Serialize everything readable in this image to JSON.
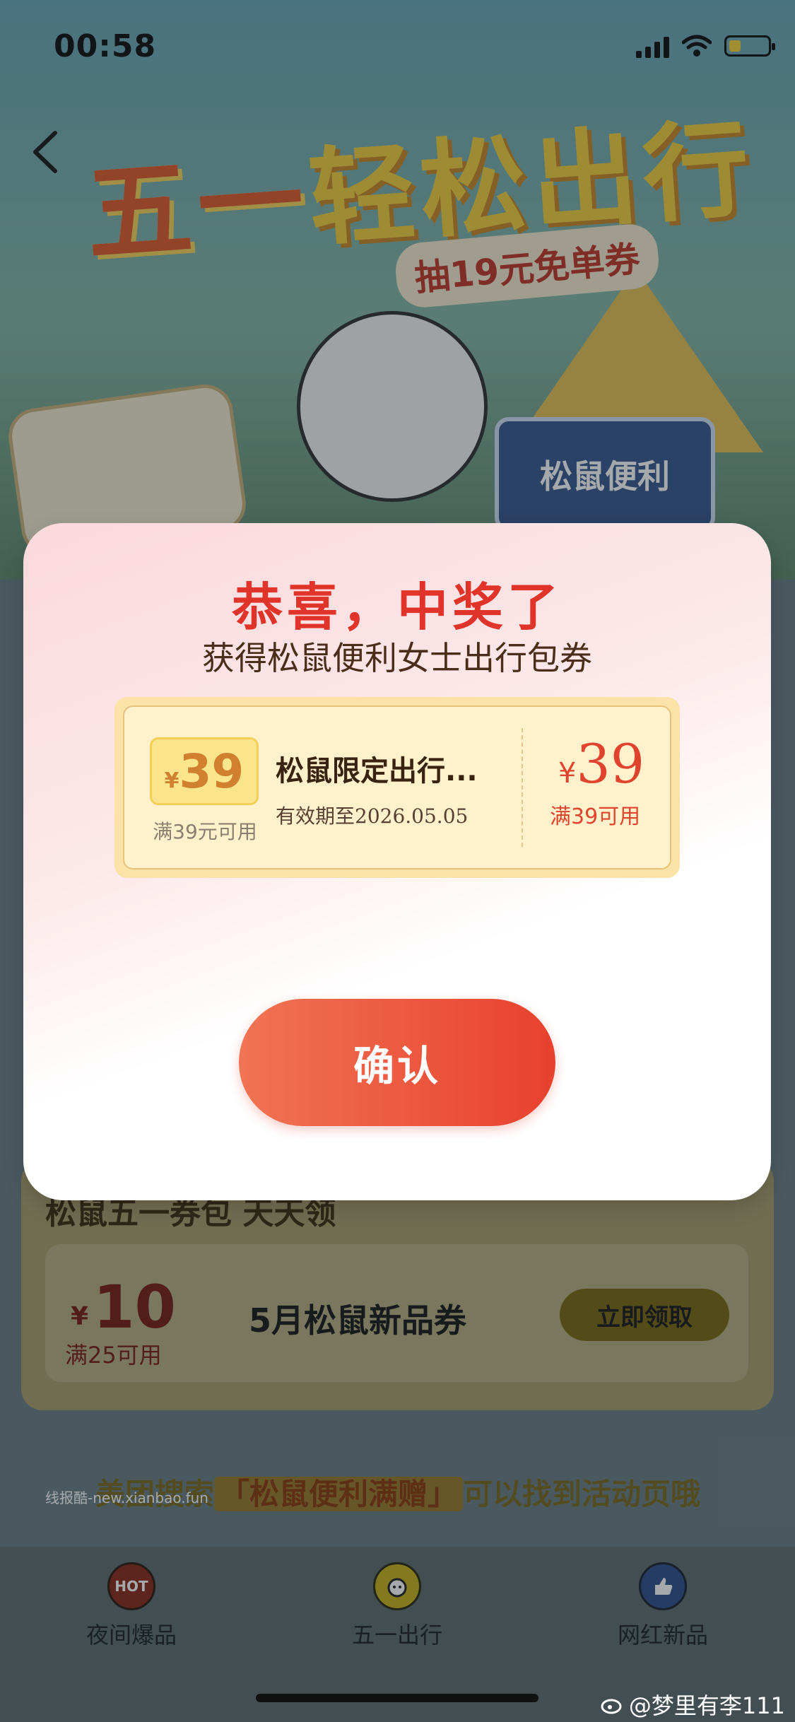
{
  "status": {
    "time": "00:58"
  },
  "hero": {
    "title_a": "五一",
    "title_b": "轻松出行",
    "subtitle": "抽19元免单券",
    "sign_text": "松鼠便利"
  },
  "modal": {
    "title": "恭喜，中奖了",
    "subtitle": "获得松鼠便利女士出行包券",
    "prize": {
      "ticket_currency": "¥",
      "ticket_amount": "39",
      "ticket_condition": "满39元可用",
      "name": "松鼠限定出行...",
      "expiry": "有效期至2026.05.05",
      "currency": "¥",
      "amount": "39",
      "condition": "满39可用"
    },
    "confirm_label": "确认"
  },
  "coupon_section": {
    "title": "松鼠五一券包 天天领",
    "coupon": {
      "currency": "¥",
      "amount": "10",
      "condition": "满25可用",
      "name": "5月松鼠新品券",
      "button": "立即领取"
    }
  },
  "search_tip": {
    "prefix": "美团搜索",
    "keyword": "「松鼠便利满赠」",
    "suffix": "可以找到活动页哦"
  },
  "watermark": "线报酷-new.xianbao.fun",
  "tabs": [
    {
      "label": "夜间爆品",
      "icon": "hot-icon",
      "icon_text": "HOT"
    },
    {
      "label": "五一出行",
      "icon": "squirrel-icon",
      "icon_text": ""
    },
    {
      "label": "网红新品",
      "icon": "thumbs-up-icon",
      "icon_text": ""
    }
  ],
  "weibo_handle": "@梦里有李111",
  "colors": {
    "accent": "#e0332a",
    "button": "#e8412e",
    "coupon_bg": "#fff1cc"
  }
}
